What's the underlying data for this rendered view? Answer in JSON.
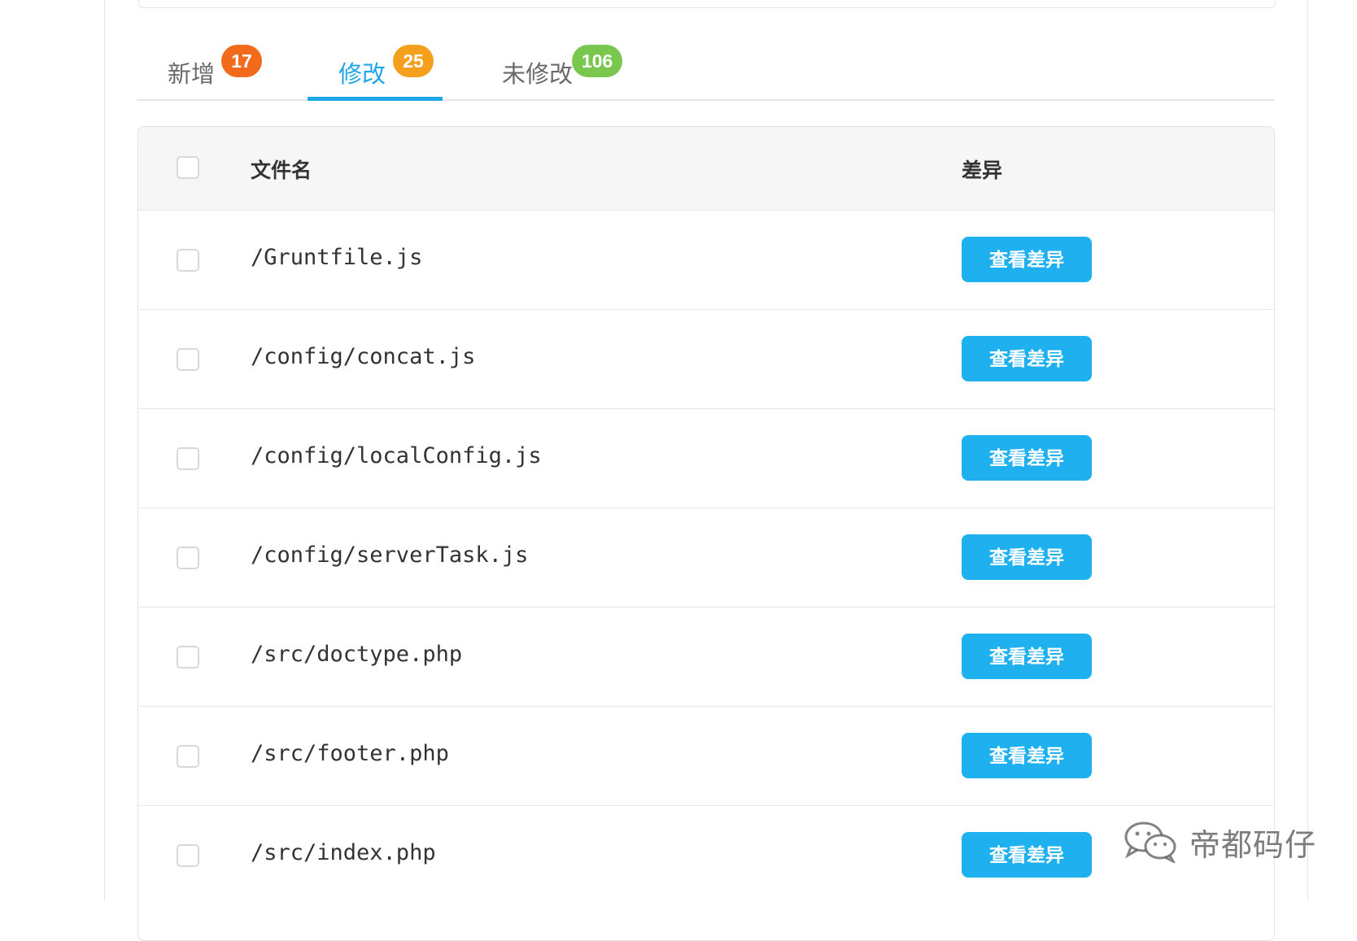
{
  "tabs": [
    {
      "label": "新增",
      "count": "17",
      "badge_color": "#f26a1b"
    },
    {
      "label": "修改",
      "count": "25",
      "badge_color": "#f5a01d"
    },
    {
      "label": "未修改",
      "count": "106",
      "badge_color": "#7ac74f"
    }
  ],
  "active_tab": "修改",
  "accent_color": "#1fa6e8",
  "table": {
    "headers": {
      "filename": "文件名",
      "diff": "差异"
    },
    "rows": [
      {
        "filename": "/Gruntfile.js",
        "action": "查看差异"
      },
      {
        "filename": "/config/concat.js",
        "action": "查看差异"
      },
      {
        "filename": "/config/localConfig.js",
        "action": "查看差异"
      },
      {
        "filename": "/config/serverTask.js",
        "action": "查看差异"
      },
      {
        "filename": "/src/doctype.php",
        "action": "查看差异"
      },
      {
        "filename": "/src/footer.php",
        "action": "查看差异"
      },
      {
        "filename": "/src/index.php",
        "action": "查看差异"
      }
    ]
  },
  "watermark": {
    "text": "帝都码仔",
    "icon": "wechat-icon"
  }
}
